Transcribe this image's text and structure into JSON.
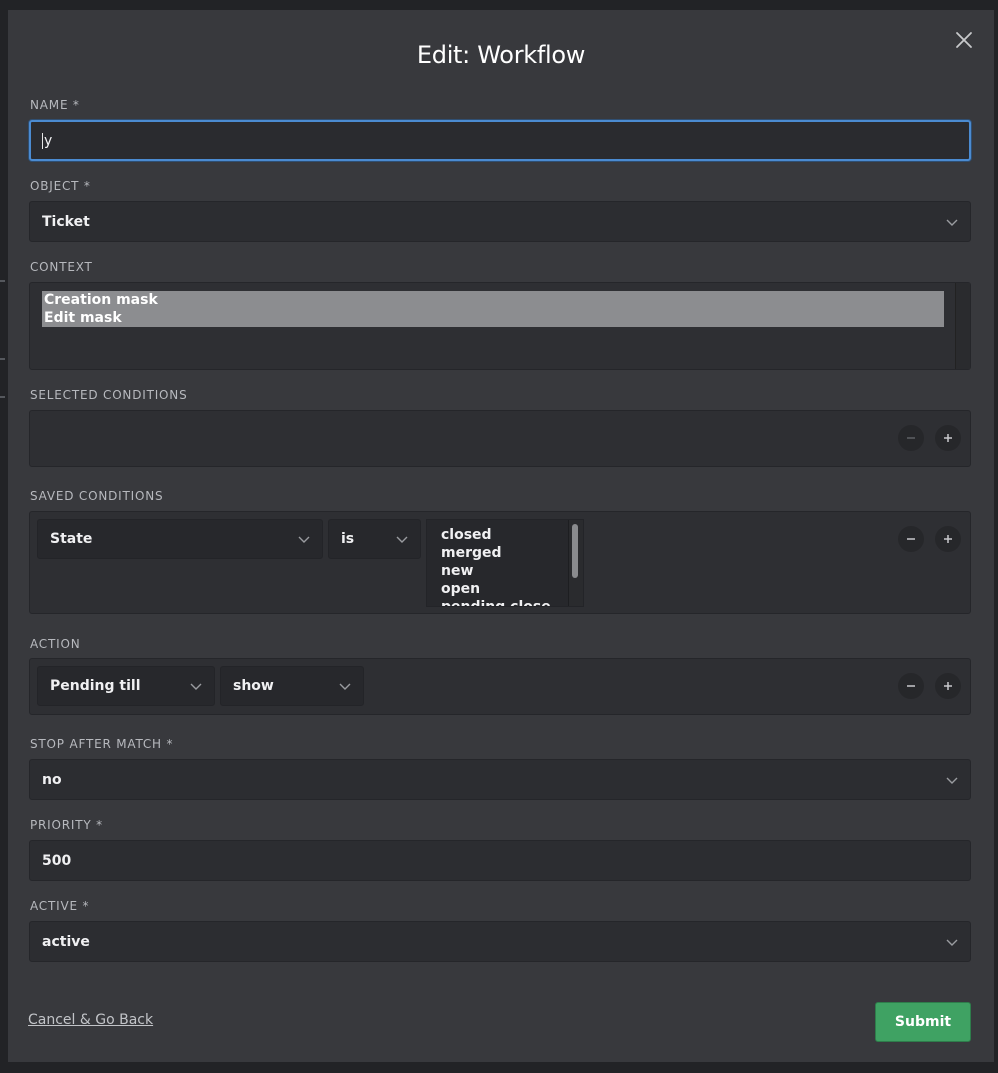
{
  "modal": {
    "title": "Edit: Workflow",
    "close_icon": "close-icon"
  },
  "fields": {
    "name": {
      "label": "NAME *",
      "value": "y"
    },
    "object": {
      "label": "OBJECT *",
      "value": "Ticket"
    },
    "context": {
      "label": "CONTEXT",
      "options": [
        "Creation mask",
        "Edit mask"
      ]
    },
    "selected_conditions": {
      "label": "SELECTED CONDITIONS"
    },
    "saved_conditions": {
      "label": "SAVED CONDITIONS",
      "attribute": "State",
      "operator": "is",
      "values": [
        "closed",
        "merged",
        "new",
        "open",
        "pending close"
      ]
    },
    "action": {
      "label": "ACTION",
      "attribute": "Pending till",
      "operation": "show"
    },
    "stop_after_match": {
      "label": "STOP AFTER MATCH *",
      "value": "no"
    },
    "priority": {
      "label": "PRIORITY *",
      "value": "500"
    },
    "active": {
      "label": "ACTIVE *",
      "value": "active"
    }
  },
  "footer": {
    "cancel_label": "Cancel & Go Back",
    "submit_label": "Submit"
  },
  "colors": {
    "accent": "#4b8bd1",
    "submit": "#3fa263",
    "modal_bg": "#38393d"
  }
}
